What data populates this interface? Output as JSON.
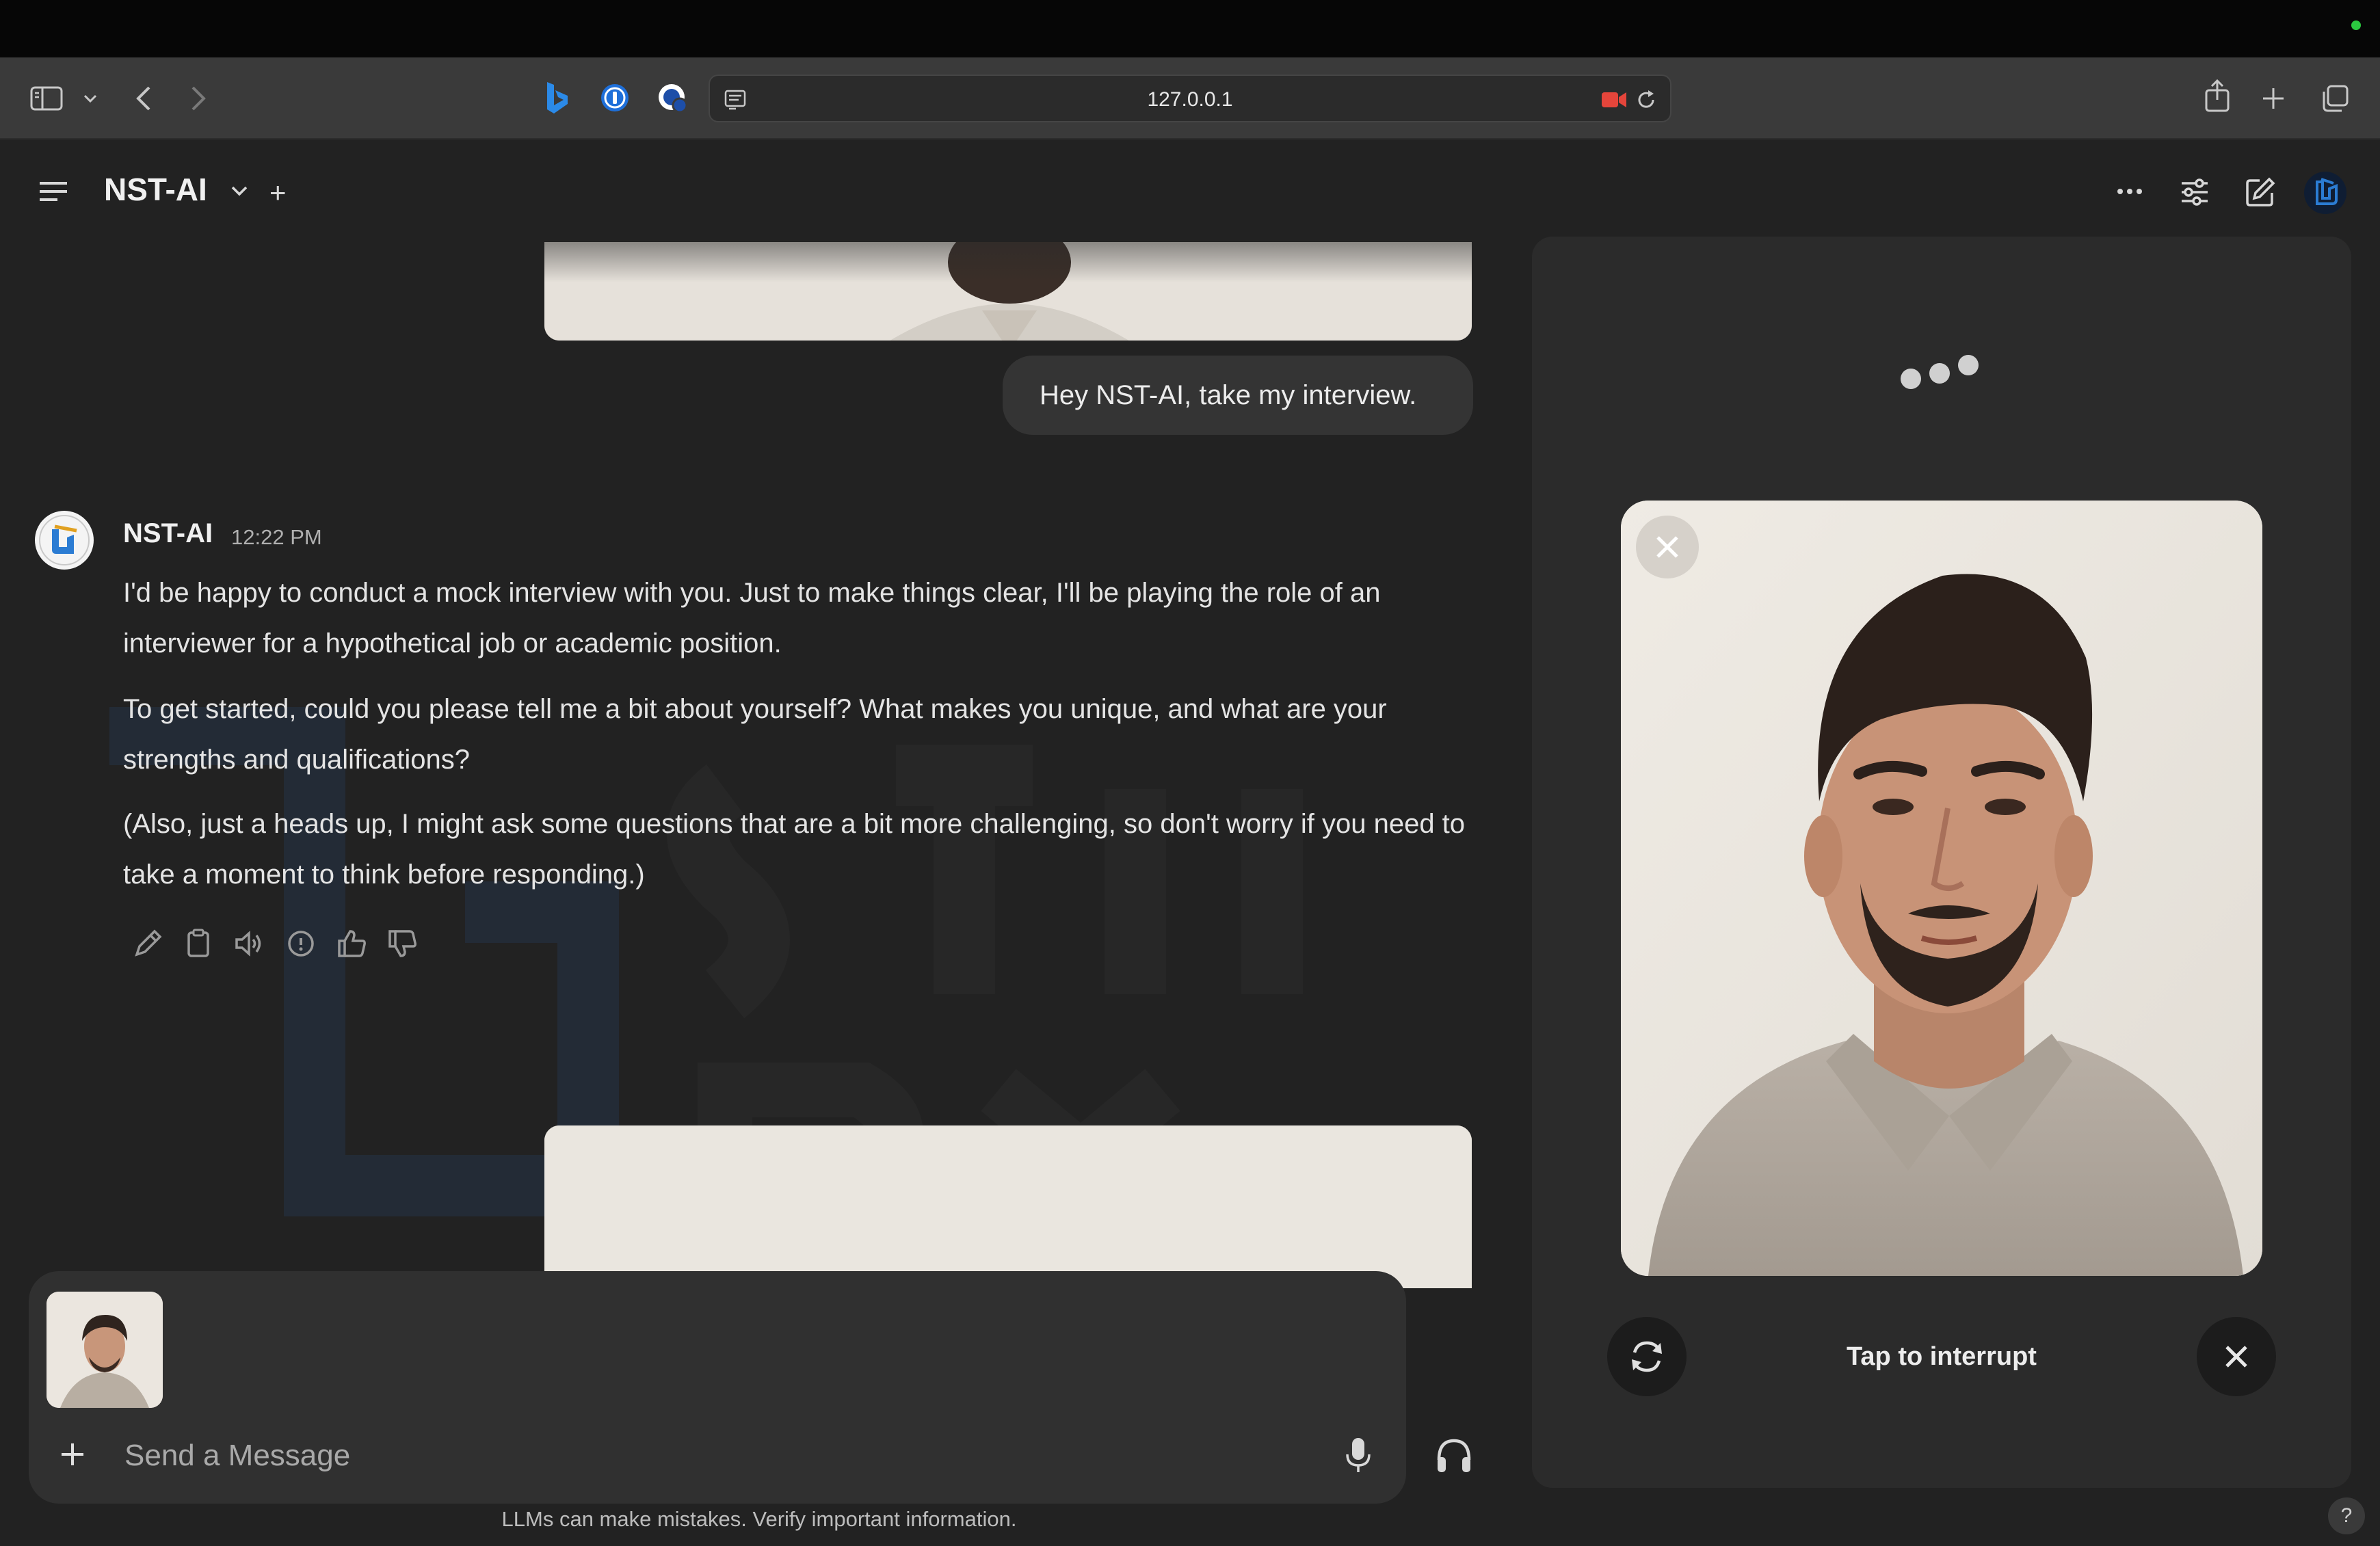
{
  "browser": {
    "url": "127.0.0.1"
  },
  "app": {
    "model_name": "NST-AI",
    "new_chat_symbol": "+"
  },
  "chat": {
    "user_message": "Hey NST-AI, take my interview.",
    "assistant": {
      "name": "NST-AI",
      "time": "12:22 PM",
      "paragraphs": [
        "I'd be happy to conduct a mock interview with you. Just to make things clear, I'll be playing the role of an interviewer for a hypothetical job or academic position.",
        "To get started, could you please tell me a bit about yourself? What makes you unique, and what are your strengths and qualifications?",
        "(Also, just a heads up, I might ask some questions that are a bit more challenging, so don't worry if you need to take a moment to think before responding.)"
      ]
    }
  },
  "composer": {
    "placeholder": "Send a Message"
  },
  "footer": {
    "disclaimer": "LLMs can make mistakes. Verify important information.",
    "help_symbol": "?"
  },
  "call": {
    "tap_label": "Tap to interrupt"
  },
  "colors": {
    "background": "#222222",
    "panel": "#2b2b2b",
    "bubble": "#343434",
    "record_red": "#e5453b",
    "logo_blue": "#2b7cd3"
  }
}
